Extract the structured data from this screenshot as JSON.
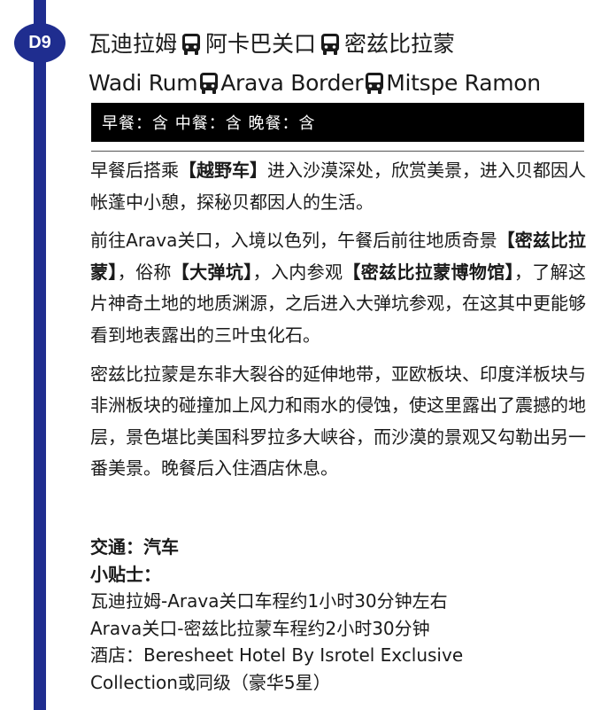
{
  "day": {
    "badge": "D9",
    "title_cn": [
      "瓦迪拉姆",
      "阿卡巴关口",
      "密兹比拉蒙"
    ],
    "title_en": [
      "Wadi Rum",
      "Arava Border",
      "Mitspe Ramon"
    ],
    "route_icon": "bus-icon"
  },
  "meals": {
    "breakfast": "早餐：含",
    "lunch": "中餐：含",
    "dinner": "晚餐：含"
  },
  "paragraphs": {
    "p1": {
      "a": "早餐后搭乘",
      "b": "【越野车】",
      "c": "进入沙漠深处，欣赏美景，进入贝都因人帐蓬中小憩，探秘贝都因人的生活。"
    },
    "p2": {
      "a": "前往Arava关口，入境以色列，午餐后前往地质奇景",
      "b": "【密兹比拉蒙】",
      "c": "，俗称",
      "d": "【大弹坑】",
      "e": "，入内参观",
      "f": "【密兹比拉蒙博物馆】",
      "g": "，了解这片神奇土地的地质渊源，之后进入大弹坑参观，在这其中更能够看到地表露出的三叶虫化石。"
    },
    "p3": "密兹比拉蒙是东非大裂谷的延伸地带，亚欧板块、印度洋板块与非洲板块的碰撞加上风力和雨水的侵蚀，使这里露出了震撼的地层，景色堪比美国科罗拉多大峡谷，而沙漠的景观又勾勒出另一番美景。晚餐后入住酒店休息。"
  },
  "info": {
    "transport": "交通：汽车",
    "tips_label": "小贴士：",
    "tip1": "瓦迪拉姆-Arava关口车程约1小时30分钟左右",
    "tip2": "Arava关口-密兹比拉蒙车程约2小时30分钟",
    "hotel_line1": "酒店：Beresheet Hotel By Isrotel Exclusive",
    "hotel_line2": "Collection或同级（豪华5星）"
  },
  "colors": {
    "accent": "#1f2d8f",
    "meal_bar": "#000000",
    "text": "#1a1a1a"
  }
}
